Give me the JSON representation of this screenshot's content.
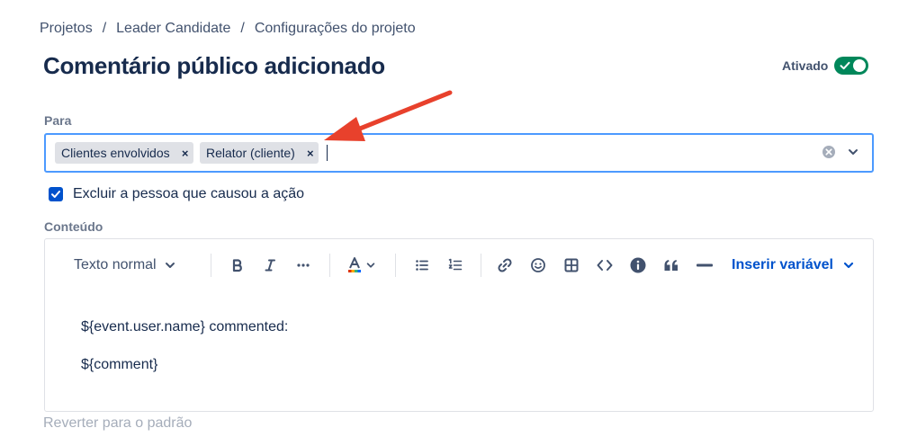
{
  "breadcrumb": {
    "items": [
      "Projetos",
      "Leader Candidate",
      "Configurações do projeto"
    ],
    "separator": "/"
  },
  "page_title": "Comentário público adicionado",
  "status_toggle": {
    "label": "Ativado",
    "enabled": true,
    "color": "#00875a"
  },
  "recipients": {
    "label": "Para",
    "chips": [
      "Clientes envolvidos",
      "Relator (cliente)"
    ],
    "chip_remove_glyph": "×"
  },
  "exclude_actor": {
    "label": "Excluir a pessoa que causou a ação",
    "checked": true
  },
  "content": {
    "label": "Conteúdo",
    "toolbar": {
      "text_style": "Texto normal",
      "insert_variable": "Inserir variável",
      "icons": [
        "bold-icon",
        "italic-icon",
        "more-formatting-icon",
        "text-color-icon",
        "bullet-list-icon",
        "numbered-list-icon",
        "link-icon",
        "emoji-icon",
        "table-icon",
        "code-icon",
        "info-panel-icon",
        "quote-icon",
        "divider-icon"
      ]
    },
    "lines": [
      "${event.user.name} commented:",
      "${comment}"
    ]
  },
  "revert_link": "Reverter para o padrão",
  "colors": {
    "accent": "#0052cc",
    "focus_border": "#4c9aff",
    "annotation_arrow": "#e8412c"
  }
}
